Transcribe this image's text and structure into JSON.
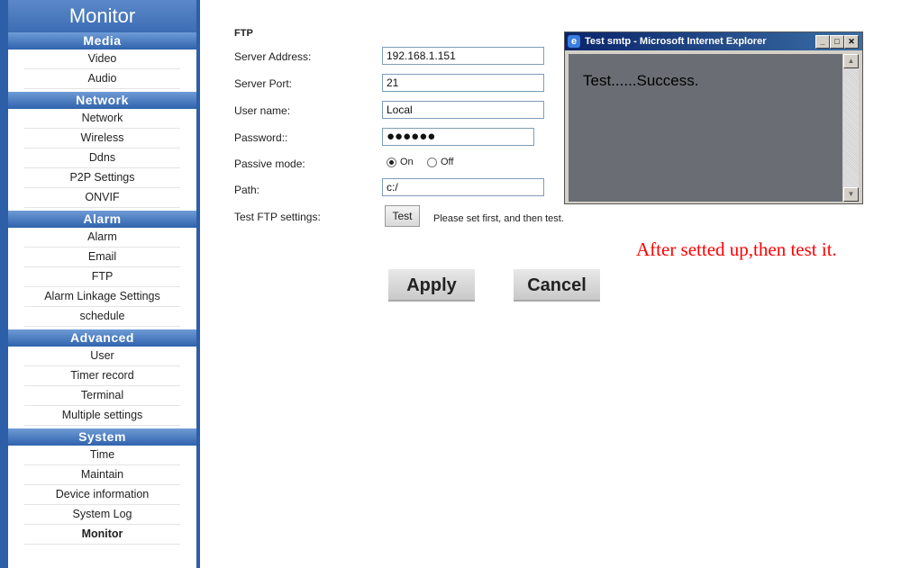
{
  "sidebar": {
    "title": "Monitor",
    "sections": [
      {
        "header": "Media",
        "items": [
          "Video",
          "Audio"
        ]
      },
      {
        "header": "Network",
        "items": [
          "Network",
          "Wireless",
          "Ddns",
          "P2P Settings",
          "ONVIF"
        ]
      },
      {
        "header": "Alarm",
        "items": [
          "Alarm",
          "Email",
          "FTP",
          "Alarm Linkage Settings",
          "schedule"
        ]
      },
      {
        "header": "Advanced",
        "items": [
          "User",
          "Timer record",
          "Terminal",
          "Multiple settings"
        ]
      },
      {
        "header": "System",
        "items": [
          "Time",
          "Maintain",
          "Device information",
          "System Log",
          "Monitor"
        ]
      }
    ]
  },
  "form": {
    "heading": "FTP",
    "server_address": {
      "label": "Server Address:",
      "value": "192.168.1.151"
    },
    "server_port": {
      "label": "Server Port:",
      "value": "21"
    },
    "user_name": {
      "label": "User name:",
      "value": "Local"
    },
    "password": {
      "label": "Password::",
      "masked": "●●●●●●"
    },
    "passive_mode": {
      "label": "Passive mode:",
      "on_label": "On",
      "off_label": "Off",
      "selected": "On"
    },
    "path": {
      "label": "Path:",
      "value": "c:/"
    },
    "test": {
      "label": "Test FTP settings:",
      "button": "Test",
      "hint": "Please set first, and then test."
    },
    "apply_label": "Apply",
    "cancel_label": "Cancel"
  },
  "popup": {
    "title": "Test smtp - Microsoft Internet Explorer",
    "message": "Test......Success.",
    "icon": "ie-icon"
  },
  "annotation": "After setted up,then test it.",
  "colors": {
    "sidebar_blue": "#2d5fa8",
    "annotation_red": "#ff0000",
    "popup_bg": "#6a6e74"
  }
}
